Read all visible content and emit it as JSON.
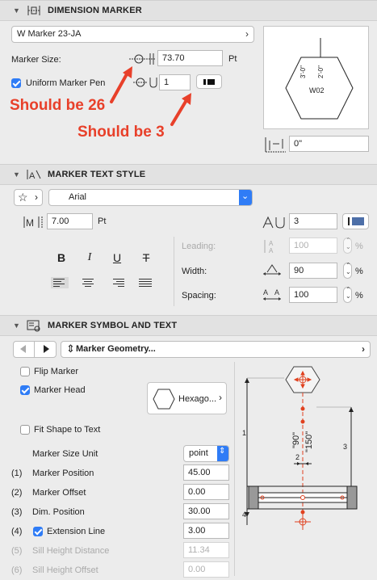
{
  "dimension_marker": {
    "header": "DIMENSION MARKER",
    "marker_type": "W Marker 23-JA",
    "marker_size_label": "Marker Size:",
    "marker_size_value": "73.70",
    "marker_size_unit": "Pt",
    "uniform_pen_label": "Uniform Marker Pen",
    "uniform_pen_checked": true,
    "pen_value": "1",
    "preview_tag": "W02",
    "preview_dim_left": "3'-0\"",
    "preview_dim_right": "2'-0\"",
    "offset_value": "0\"",
    "annotation_1": "Should be 26",
    "annotation_2": "Should be 3",
    "annotation_color": "#e8402a"
  },
  "marker_text_style": {
    "header": "MARKER TEXT STYLE",
    "font_name": "Arial",
    "font_size": "7.00",
    "font_size_unit": "Pt",
    "text_pen": "3",
    "text_color_swatch": "#4d6fa8",
    "bold_label": "B",
    "italic_label": "I",
    "underline_label": "U",
    "strike_label": "T",
    "leading_label": "Leading:",
    "leading_value": "100",
    "width_label": "Width:",
    "width_value": "90",
    "spacing_label": "Spacing:",
    "spacing_value": "100",
    "percent": "%"
  },
  "marker_symbol": {
    "header": "MARKER SYMBOL AND TEXT",
    "geometry_label": "Marker Geometry...",
    "flip_marker_label": "Flip Marker",
    "flip_marker_checked": false,
    "marker_head_label": "Marker Head",
    "marker_head_checked": true,
    "head_shape": "Hexago...",
    "fit_shape_label": "Fit Shape to Text",
    "fit_shape_checked": false,
    "size_unit_label": "Marker Size Unit",
    "size_unit_value": "point",
    "rows": [
      {
        "num": "(1)",
        "label": "Marker Position",
        "value": "45.00",
        "enabled": true
      },
      {
        "num": "(2)",
        "label": "Marker Offset",
        "value": "0.00",
        "enabled": true
      },
      {
        "num": "(3)",
        "label": "Dim. Position",
        "value": "30.00",
        "enabled": true
      },
      {
        "num": "(4)",
        "label": "Extension Line",
        "value": "3.00",
        "enabled": true,
        "checked": true
      },
      {
        "num": "(5)",
        "label": "Sill Height Distance",
        "value": "11.34",
        "enabled": false
      },
      {
        "num": "(6)",
        "label": "Sill Height Offset",
        "value": "0.00",
        "enabled": false
      }
    ],
    "diagram_label_90": "\"90\"",
    "diagram_label_150": "\"150\"",
    "diagram_label_1": "1",
    "diagram_label_2": "2",
    "diagram_label_3": "3",
    "diagram_label_4": "4",
    "accent_color": "#e0411f"
  },
  "colors": {
    "accent_blue": "#2f7cf6",
    "panel_bg": "#ececec",
    "header_bg": "#e2e2e2"
  }
}
